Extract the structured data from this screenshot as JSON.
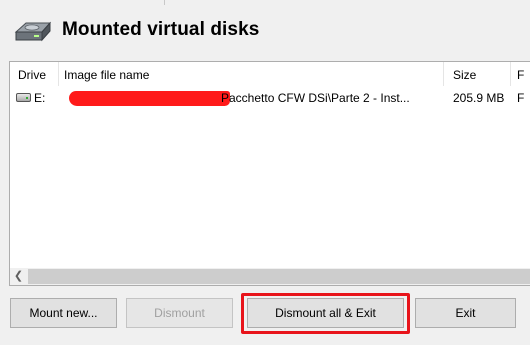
{
  "window": {
    "title": "Mounted virtual disks"
  },
  "icons": {
    "app": "disk-drive-icon",
    "drive": "drive-icon",
    "scroll_left": "chevron-left-icon"
  },
  "listview": {
    "columns": [
      "Drive",
      "Image file name",
      "Size",
      "F"
    ],
    "rows": [
      {
        "drive": "E:",
        "image_file": "Pacchetto CFW DSi\\Parte 2 - Inst...",
        "size": "205.9 MB",
        "extra": "F"
      }
    ]
  },
  "buttons": {
    "mount_new": "Mount new...",
    "dismount": "Dismount",
    "dismount_all_exit": "Dismount all & Exit",
    "exit": "Exit"
  },
  "colors": {
    "highlight": "#e8141b",
    "redaction": "#ff1a1a"
  }
}
